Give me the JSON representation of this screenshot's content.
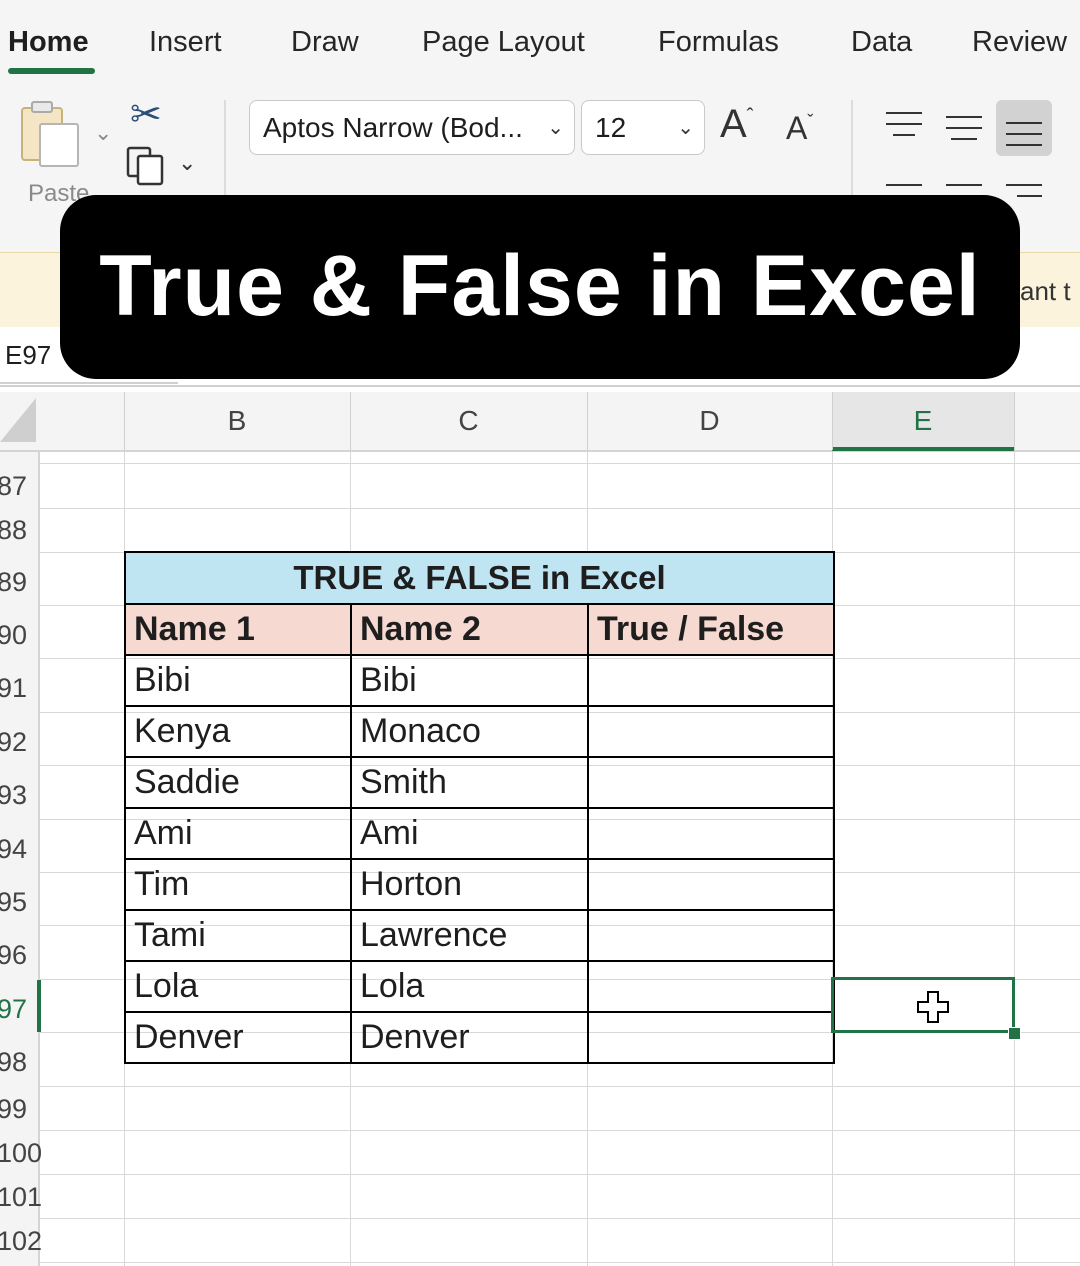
{
  "ribbon": {
    "tabs": [
      {
        "label": "Home",
        "active": true
      },
      {
        "label": "Insert"
      },
      {
        "label": "Draw"
      },
      {
        "label": "Page Layout"
      },
      {
        "label": "Formulas"
      },
      {
        "label": "Data"
      },
      {
        "label": "Review"
      }
    ],
    "paste_label": "Paste",
    "font_name": "Aptos Narrow (Bod...",
    "font_size": "12",
    "grow_font": "A",
    "shrink_font": "A"
  },
  "notification_partial": "ant t",
  "formula_bar": {
    "name_box": "E97"
  },
  "overlay_title": "True & False in Excel",
  "columns": [
    "B",
    "C",
    "D",
    "E"
  ],
  "selected_column": "E",
  "rows": [
    "87",
    "88",
    "89",
    "90",
    "91",
    "92",
    "93",
    "94",
    "95",
    "96",
    "97",
    "98",
    "99",
    "100",
    "101",
    "102"
  ],
  "selected_row": "97",
  "table": {
    "title": "TRUE & FALSE in Excel",
    "headers": [
      "Name 1",
      "Name 2",
      "True / False"
    ],
    "rows": [
      [
        "Bibi",
        "Bibi",
        ""
      ],
      [
        "Kenya",
        "Monaco",
        ""
      ],
      [
        "Saddie",
        "Smith",
        ""
      ],
      [
        "Ami",
        "Ami",
        ""
      ],
      [
        "Tim",
        "Horton",
        ""
      ],
      [
        "Tami",
        "Lawrence",
        ""
      ],
      [
        "Lola",
        "Lola",
        ""
      ],
      [
        "Denver",
        "Denver",
        ""
      ]
    ]
  },
  "colors": {
    "accent": "#217346",
    "title_fill": "#bfe5f3",
    "header_fill": "#f6d9d0"
  }
}
